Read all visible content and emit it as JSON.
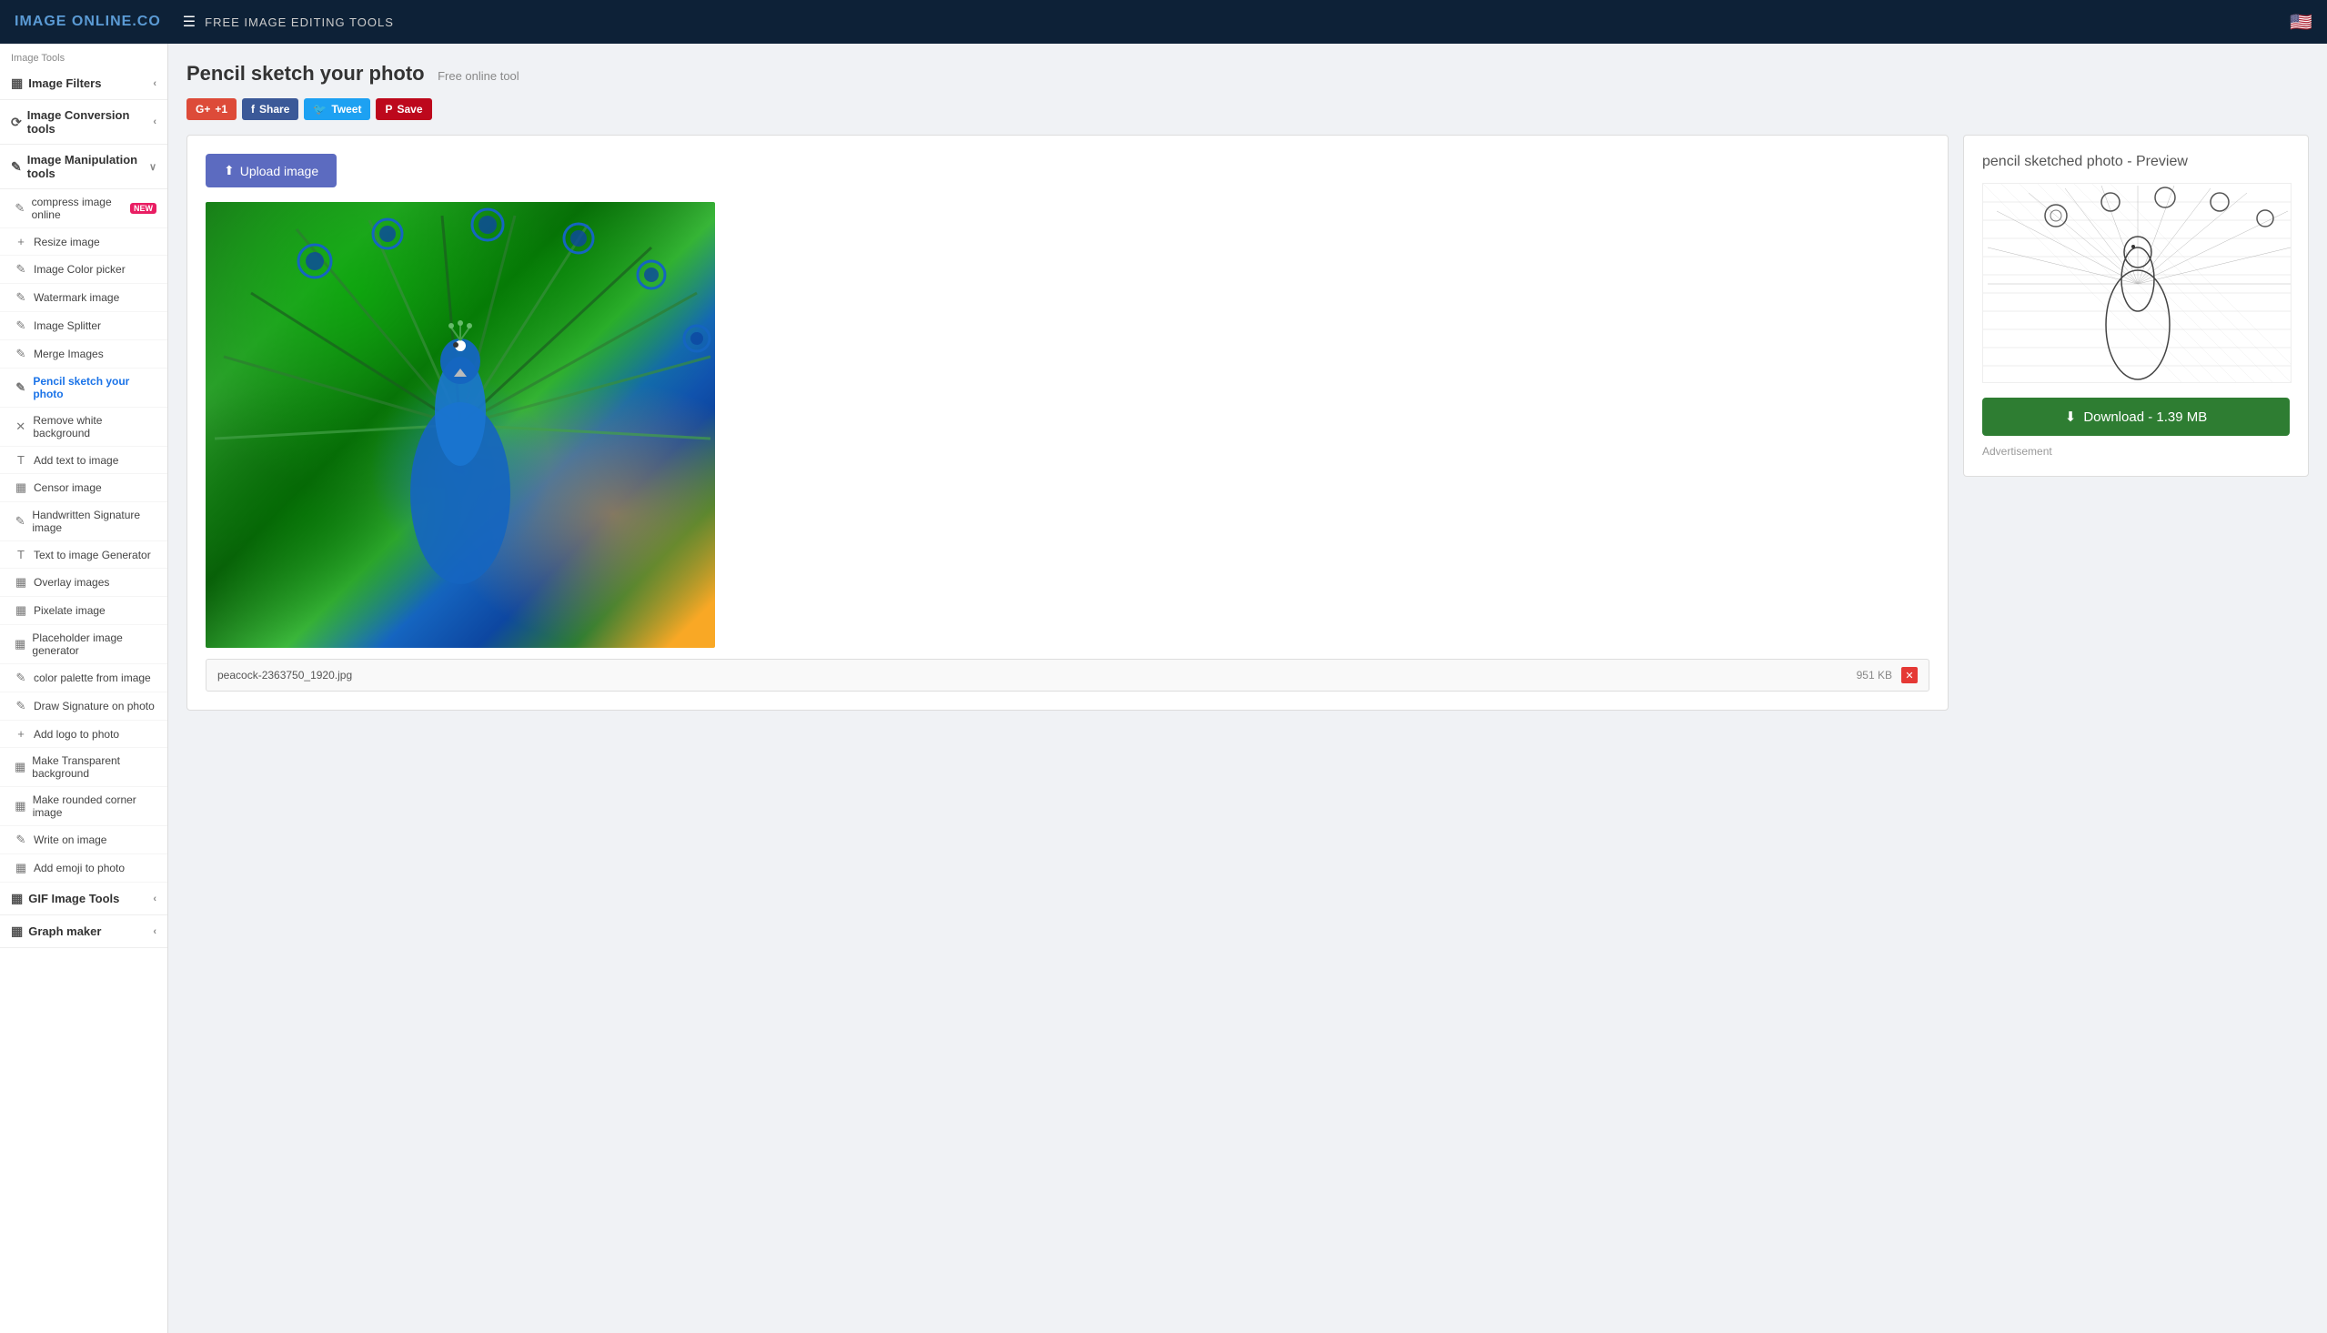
{
  "header": {
    "logo_text": "IMAGE",
    "logo_suffix": " ONLINE.CO",
    "nav_label": "FREE IMAGE EDITING TOOLS",
    "flag": "🇺🇸"
  },
  "sidebar": {
    "section_label": "Image Tools",
    "groups": [
      {
        "id": "filters",
        "icon": "▦",
        "label": "Image Filters",
        "chevron": "‹",
        "expanded": false
      },
      {
        "id": "conversion",
        "icon": "⟳",
        "label": "Image Conversion tools",
        "chevron": "‹",
        "expanded": false
      },
      {
        "id": "manipulation",
        "icon": "✎",
        "label": "Image Manipulation tools",
        "chevron": "∨",
        "expanded": true
      }
    ],
    "manipulation_items": [
      {
        "id": "compress",
        "icon": "✎",
        "label": "compress image online",
        "badge": "NEW"
      },
      {
        "id": "resize",
        "icon": "+",
        "label": "Resize image",
        "badge": null
      },
      {
        "id": "color-picker",
        "icon": "✎",
        "label": "Image Color picker",
        "badge": null
      },
      {
        "id": "watermark",
        "icon": "✎",
        "label": "Watermark image",
        "badge": null
      },
      {
        "id": "splitter",
        "icon": "✎",
        "label": "Image Splitter",
        "badge": null
      },
      {
        "id": "merge",
        "icon": "✎",
        "label": "Merge Images",
        "badge": null
      },
      {
        "id": "pencil",
        "icon": "✎",
        "label": "Pencil sketch your photo",
        "badge": null,
        "active": true
      },
      {
        "id": "remove-white",
        "icon": "✕",
        "label": "Remove white background",
        "badge": null
      },
      {
        "id": "add-text",
        "icon": "T",
        "label": "Add text to image",
        "badge": null
      },
      {
        "id": "censor",
        "icon": "▦",
        "label": "Censor image",
        "badge": null
      },
      {
        "id": "handwritten",
        "icon": "✎",
        "label": "Handwritten Signature image",
        "badge": null
      },
      {
        "id": "text-to-image",
        "icon": "T",
        "label": "Text to image Generator",
        "badge": null
      },
      {
        "id": "overlay",
        "icon": "▦",
        "label": "Overlay images",
        "badge": null
      },
      {
        "id": "pixelate",
        "icon": "▦",
        "label": "Pixelate image",
        "badge": null
      },
      {
        "id": "placeholder",
        "icon": "▦",
        "label": "Placeholder image generator",
        "badge": null
      },
      {
        "id": "color-palette",
        "icon": "✎",
        "label": "color palette from image",
        "badge": null
      },
      {
        "id": "draw-signature",
        "icon": "✎",
        "label": "Draw Signature on photo",
        "badge": null
      },
      {
        "id": "add-logo",
        "icon": "+",
        "label": "Add logo to photo",
        "badge": null
      },
      {
        "id": "transparent-bg",
        "icon": "▦",
        "label": "Make Transparent background",
        "badge": null
      },
      {
        "id": "rounded-corner",
        "icon": "▦",
        "label": "Make rounded corner image",
        "badge": null
      },
      {
        "id": "write-on-image",
        "icon": "✎",
        "label": "Write on image",
        "badge": null
      },
      {
        "id": "add-emoji",
        "icon": "▦",
        "label": "Add emoji to photo",
        "badge": null
      }
    ],
    "gif_tools": {
      "icon": "▦",
      "label": "GIF Image Tools",
      "chevron": "‹"
    },
    "graph_maker": {
      "icon": "▦",
      "label": "Graph maker",
      "chevron": "‹"
    }
  },
  "page": {
    "title": "Pencil sketch your photo",
    "subtitle": "Free online tool",
    "social_buttons": [
      {
        "id": "google",
        "label": "+1",
        "class": "btn-google"
      },
      {
        "id": "facebook",
        "label": "Share",
        "class": "btn-facebook"
      },
      {
        "id": "twitter",
        "label": "Tweet",
        "class": "btn-twitter"
      },
      {
        "id": "pinterest",
        "label": "Save",
        "class": "btn-pinterest"
      }
    ],
    "upload_button": "Upload image",
    "preview_title": "pencil sketched photo - Preview",
    "download_button": "Download - 1.39 MB",
    "advertisement": "Advertisement",
    "file": {
      "name": "peacock-2363750_1920.jpg",
      "size": "951 KB"
    }
  }
}
